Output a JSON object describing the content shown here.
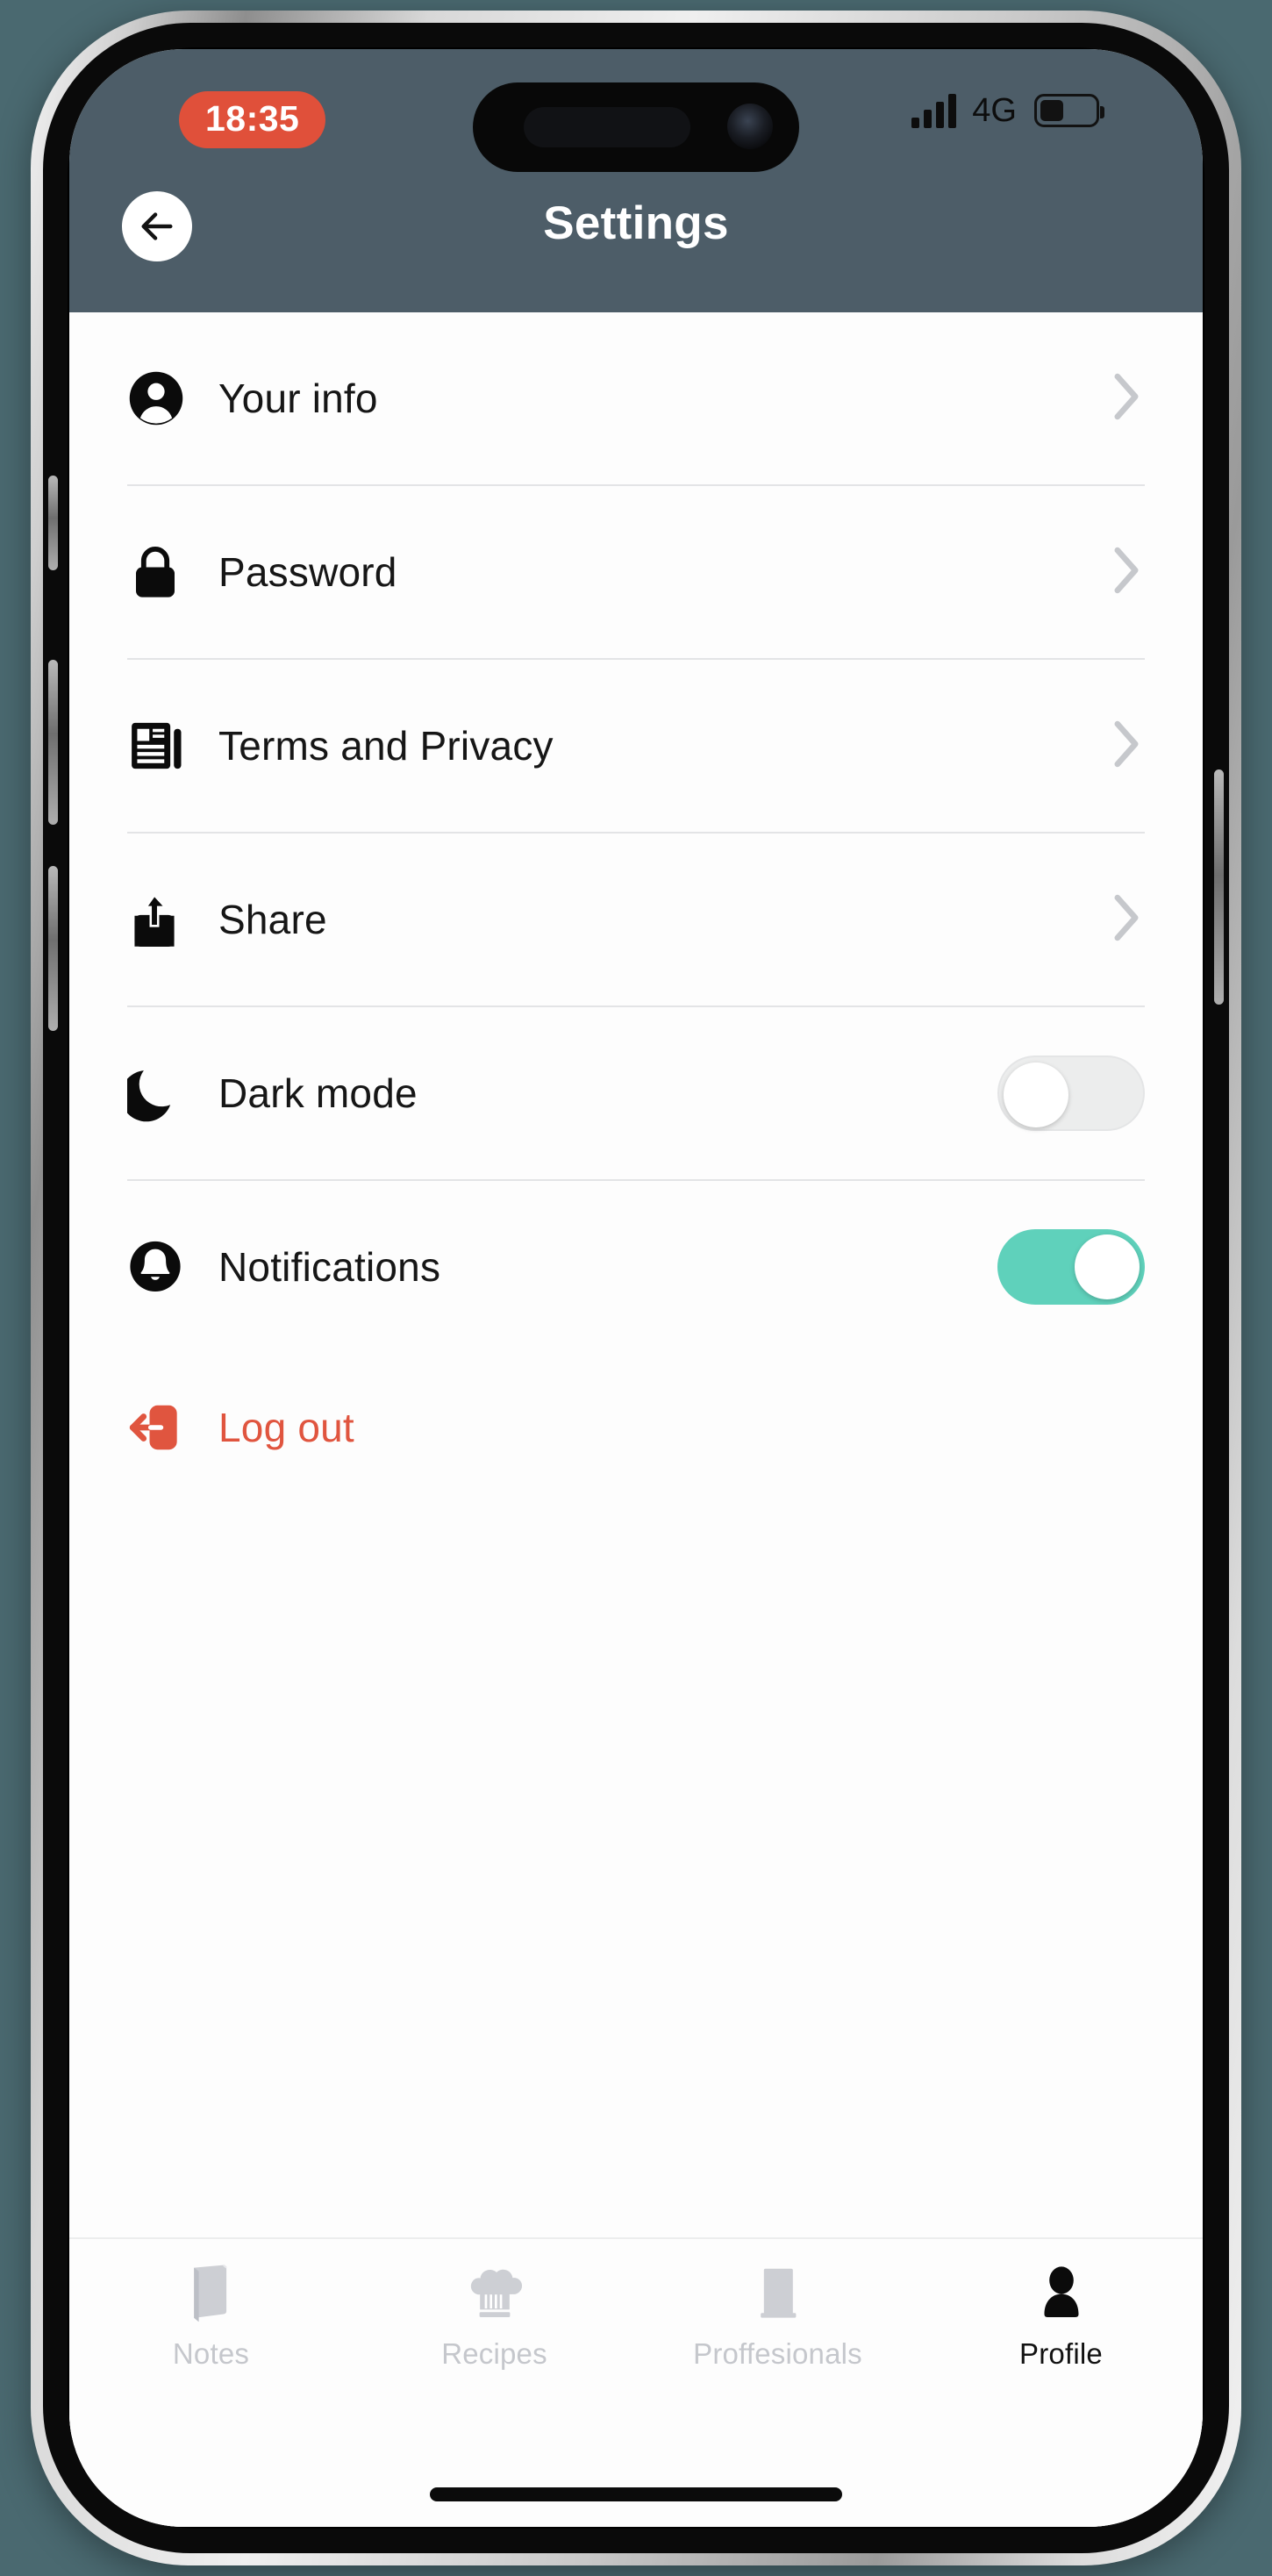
{
  "theme": {
    "background": "#4a6970",
    "header_bg": "#4d5d68",
    "accent_teal": "#5fd1bb",
    "accent_red": "#e0503a",
    "logout_red": "#e0553f",
    "text_primary": "#161616",
    "tab_inactive": "#c5c7cc"
  },
  "status_bar": {
    "time": "18:35",
    "network": "4G",
    "signal_bars": 4,
    "battery_percent": 38,
    "signal_icon": "cellular-signal-icon",
    "battery_icon": "battery-icon",
    "camera_icon": "front-camera-icon",
    "speaker_icon": "earpiece-speaker-icon"
  },
  "header": {
    "title": "Settings",
    "back_icon": "arrow-left-icon"
  },
  "settings": {
    "rows": [
      {
        "label": "Your info",
        "icon": "user-circle-icon",
        "type": "link"
      },
      {
        "label": "Password",
        "icon": "lock-icon",
        "type": "link"
      },
      {
        "label": "Terms and Privacy",
        "icon": "document-icon",
        "type": "link"
      },
      {
        "label": "Share",
        "icon": "share-icon",
        "type": "link"
      },
      {
        "label": "Dark mode",
        "icon": "moon-icon",
        "type": "toggle",
        "value": "off"
      },
      {
        "label": "Notifications",
        "icon": "bell-icon",
        "type": "toggle",
        "value": "on"
      }
    ],
    "chevron_icon": "chevron-right-icon",
    "logout": {
      "label": "Log out",
      "icon": "logout-icon"
    }
  },
  "tabbar": {
    "tabs": [
      {
        "label": "Notes",
        "icon": "book-icon",
        "active": false
      },
      {
        "label": "Recipes",
        "icon": "chef-hat-icon",
        "active": false
      },
      {
        "label": "Proffesionals",
        "icon": "briefcase-icon",
        "active": false
      },
      {
        "label": "Profile",
        "icon": "person-icon",
        "active": true
      }
    ]
  }
}
